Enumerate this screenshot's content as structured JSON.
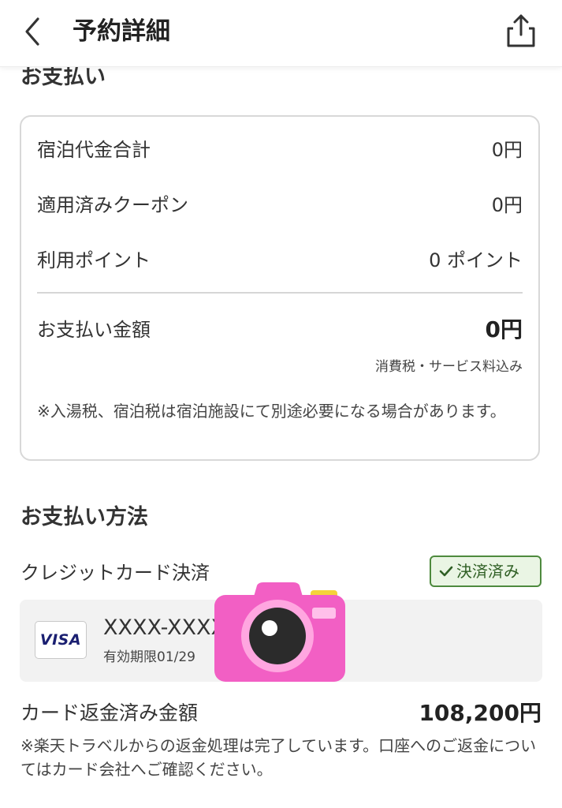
{
  "header": {
    "title": "予約詳細"
  },
  "payment": {
    "section_title": "お支払い",
    "rows": [
      {
        "label": "宿泊代金合計",
        "value": "0円"
      },
      {
        "label": "適用済みクーポン",
        "value": "0円"
      },
      {
        "label": "利用ポイント",
        "value": "0 ポイント"
      }
    ],
    "total": {
      "label": "お支払い金額",
      "value": "0円"
    },
    "tax_note": "消費税・サービス料込み",
    "note": "※入湯税、宿泊税は宿泊施設にて別途必要になる場合があります。"
  },
  "method": {
    "section_title": "お支払い方法",
    "type": "クレジットカード決済",
    "badge": "決済済み",
    "card": {
      "brand": "VISA",
      "number": "XXXX-XXXX-",
      "expiry": "有効期限01/29"
    }
  },
  "refund": {
    "label": "カード返金済み金額",
    "value": "108,200円",
    "note": "※楽天トラベルからの返金処理は完了しています。口座へのご返金についてはカード会社へご確認ください。"
  },
  "icons": {
    "back": "chevron-left-icon",
    "share": "share-icon",
    "check": "check-icon",
    "sticker": "camera-sticker"
  },
  "colors": {
    "badge_border": "#4e8a3e",
    "badge_bg": "#eaf5e4",
    "visa_blue": "#1a1f71",
    "sticker_pink": "#f25fc4"
  }
}
